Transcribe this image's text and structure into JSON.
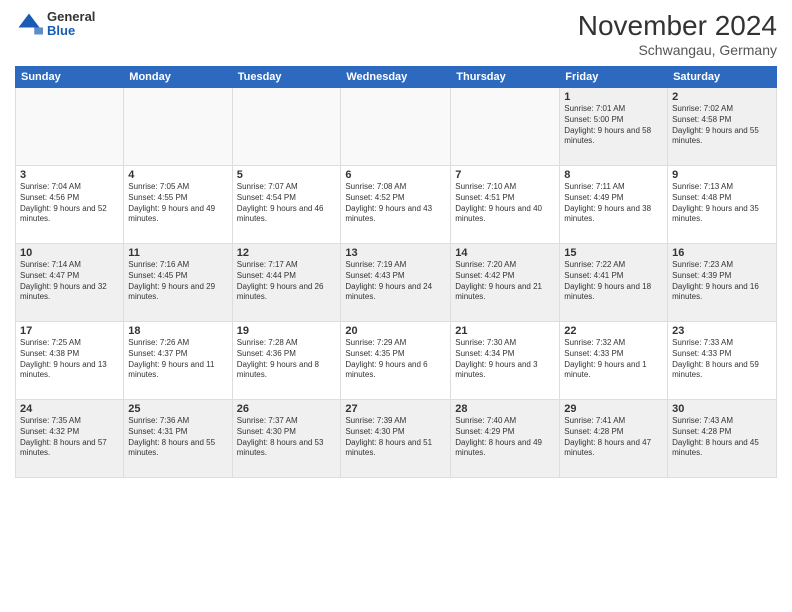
{
  "header": {
    "logo_general": "General",
    "logo_blue": "Blue",
    "month_title": "November 2024",
    "location": "Schwangau, Germany"
  },
  "weekdays": [
    "Sunday",
    "Monday",
    "Tuesday",
    "Wednesday",
    "Thursday",
    "Friday",
    "Saturday"
  ],
  "weeks": [
    [
      {
        "day": "",
        "info": "",
        "empty": true
      },
      {
        "day": "",
        "info": "",
        "empty": true
      },
      {
        "day": "",
        "info": "",
        "empty": true
      },
      {
        "day": "",
        "info": "",
        "empty": true
      },
      {
        "day": "",
        "info": "",
        "empty": true
      },
      {
        "day": "1",
        "info": "Sunrise: 7:01 AM\nSunset: 5:00 PM\nDaylight: 9 hours and 58 minutes."
      },
      {
        "day": "2",
        "info": "Sunrise: 7:02 AM\nSunset: 4:58 PM\nDaylight: 9 hours and 55 minutes."
      }
    ],
    [
      {
        "day": "3",
        "info": "Sunrise: 7:04 AM\nSunset: 4:56 PM\nDaylight: 9 hours and 52 minutes."
      },
      {
        "day": "4",
        "info": "Sunrise: 7:05 AM\nSunset: 4:55 PM\nDaylight: 9 hours and 49 minutes."
      },
      {
        "day": "5",
        "info": "Sunrise: 7:07 AM\nSunset: 4:54 PM\nDaylight: 9 hours and 46 minutes."
      },
      {
        "day": "6",
        "info": "Sunrise: 7:08 AM\nSunset: 4:52 PM\nDaylight: 9 hours and 43 minutes."
      },
      {
        "day": "7",
        "info": "Sunrise: 7:10 AM\nSunset: 4:51 PM\nDaylight: 9 hours and 40 minutes."
      },
      {
        "day": "8",
        "info": "Sunrise: 7:11 AM\nSunset: 4:49 PM\nDaylight: 9 hours and 38 minutes."
      },
      {
        "day": "9",
        "info": "Sunrise: 7:13 AM\nSunset: 4:48 PM\nDaylight: 9 hours and 35 minutes."
      }
    ],
    [
      {
        "day": "10",
        "info": "Sunrise: 7:14 AM\nSunset: 4:47 PM\nDaylight: 9 hours and 32 minutes."
      },
      {
        "day": "11",
        "info": "Sunrise: 7:16 AM\nSunset: 4:45 PM\nDaylight: 9 hours and 29 minutes."
      },
      {
        "day": "12",
        "info": "Sunrise: 7:17 AM\nSunset: 4:44 PM\nDaylight: 9 hours and 26 minutes."
      },
      {
        "day": "13",
        "info": "Sunrise: 7:19 AM\nSunset: 4:43 PM\nDaylight: 9 hours and 24 minutes."
      },
      {
        "day": "14",
        "info": "Sunrise: 7:20 AM\nSunset: 4:42 PM\nDaylight: 9 hours and 21 minutes."
      },
      {
        "day": "15",
        "info": "Sunrise: 7:22 AM\nSunset: 4:41 PM\nDaylight: 9 hours and 18 minutes."
      },
      {
        "day": "16",
        "info": "Sunrise: 7:23 AM\nSunset: 4:39 PM\nDaylight: 9 hours and 16 minutes."
      }
    ],
    [
      {
        "day": "17",
        "info": "Sunrise: 7:25 AM\nSunset: 4:38 PM\nDaylight: 9 hours and 13 minutes."
      },
      {
        "day": "18",
        "info": "Sunrise: 7:26 AM\nSunset: 4:37 PM\nDaylight: 9 hours and 11 minutes."
      },
      {
        "day": "19",
        "info": "Sunrise: 7:28 AM\nSunset: 4:36 PM\nDaylight: 9 hours and 8 minutes."
      },
      {
        "day": "20",
        "info": "Sunrise: 7:29 AM\nSunset: 4:35 PM\nDaylight: 9 hours and 6 minutes."
      },
      {
        "day": "21",
        "info": "Sunrise: 7:30 AM\nSunset: 4:34 PM\nDaylight: 9 hours and 3 minutes."
      },
      {
        "day": "22",
        "info": "Sunrise: 7:32 AM\nSunset: 4:33 PM\nDaylight: 9 hours and 1 minute."
      },
      {
        "day": "23",
        "info": "Sunrise: 7:33 AM\nSunset: 4:33 PM\nDaylight: 8 hours and 59 minutes."
      }
    ],
    [
      {
        "day": "24",
        "info": "Sunrise: 7:35 AM\nSunset: 4:32 PM\nDaylight: 8 hours and 57 minutes."
      },
      {
        "day": "25",
        "info": "Sunrise: 7:36 AM\nSunset: 4:31 PM\nDaylight: 8 hours and 55 minutes."
      },
      {
        "day": "26",
        "info": "Sunrise: 7:37 AM\nSunset: 4:30 PM\nDaylight: 8 hours and 53 minutes."
      },
      {
        "day": "27",
        "info": "Sunrise: 7:39 AM\nSunset: 4:30 PM\nDaylight: 8 hours and 51 minutes."
      },
      {
        "day": "28",
        "info": "Sunrise: 7:40 AM\nSunset: 4:29 PM\nDaylight: 8 hours and 49 minutes."
      },
      {
        "day": "29",
        "info": "Sunrise: 7:41 AM\nSunset: 4:28 PM\nDaylight: 8 hours and 47 minutes."
      },
      {
        "day": "30",
        "info": "Sunrise: 7:43 AM\nSunset: 4:28 PM\nDaylight: 8 hours and 45 minutes."
      }
    ]
  ]
}
